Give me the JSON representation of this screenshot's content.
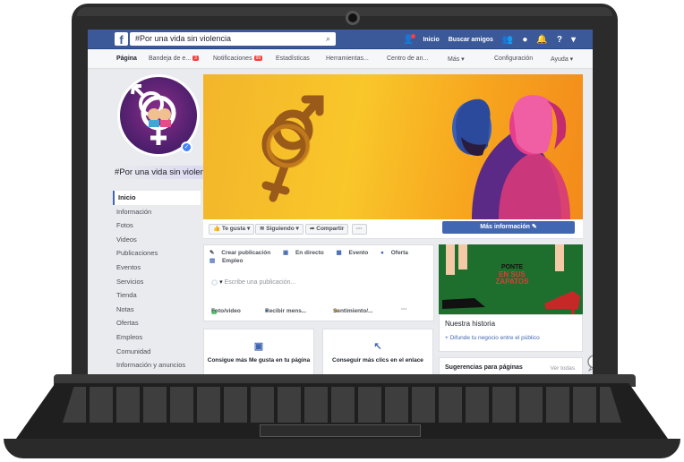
{
  "topbar": {
    "logo": "f",
    "search_value": "#Por una vida sin violencia",
    "search_icon": "search-icon",
    "home_label": "Inicio",
    "find_friends_label": "Buscar amigos"
  },
  "pagenav": {
    "tabs": [
      "Página",
      "Bandeja de e...",
      "Notificaciones",
      "Estadísticas",
      "Herramientas...",
      "Centro de an...",
      "Más ▾",
      "Configuración",
      "Ayuda ▾"
    ],
    "inbox_badge": "3",
    "notif_badge": "99"
  },
  "page": {
    "name": "#Por una vida sin violencia",
    "menu": [
      "Inicio",
      "Información",
      "Fotos",
      "Videos",
      "Publicaciones",
      "Eventos",
      "Servicios",
      "Tienda",
      "Notas",
      "Ofertas",
      "Empleos",
      "Comunidad",
      "Información y anuncios"
    ]
  },
  "actions": {
    "like": "👍 Te gusta ▾",
    "following": "Siguiendo ▾",
    "share": "➦ Compartir",
    "more": "···",
    "more_info": "Más información ✎"
  },
  "composer": {
    "create_post": "Crear publicación",
    "live": "En directo",
    "event": "Evento",
    "offer": "Oferta",
    "job": "Empleo",
    "placeholder": "Escribe una publicación...",
    "photo_video": "Foto/video",
    "receive_messages": "Recibir mens...",
    "feeling": "Sentimiento/...",
    "more": "···"
  },
  "cards": [
    {
      "label": "Consigue más Me gusta en tu página"
    },
    {
      "label": "Conseguir más clics en el enlace"
    }
  ],
  "ad": {
    "line1": "PONTE",
    "line2": "EN SUS",
    "line3": "ZAPATOS"
  },
  "story": {
    "title": "Nuestra historia",
    "link": "+ Difunde tu negocio entre el público"
  },
  "suggestions": {
    "title": "Sugerencias para páginas",
    "see_all": "Ver todas"
  },
  "colors": {
    "fb_blue": "#3b5998",
    "button_blue": "#4267b2",
    "cover_yellow": "#f9c72a",
    "ad_green": "#1e6e2e"
  }
}
